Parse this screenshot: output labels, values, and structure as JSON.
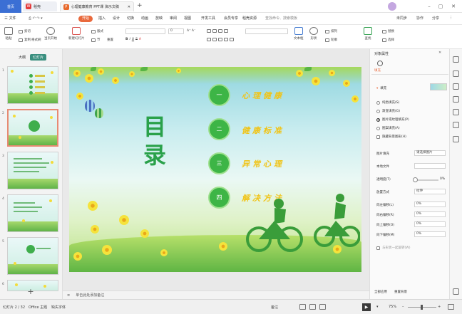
{
  "titlebar": {
    "home_tab": "首页",
    "wps_tab": "稻壳",
    "doc_tab": "心理健康教育 PPT课 演示文稿",
    "add_tab": "+",
    "minimize": "–",
    "restore": "▢",
    "close": "✕"
  },
  "menubar": {
    "file": "三 文件",
    "items": [
      "开始",
      "插入",
      "设计",
      "切换",
      "动画",
      "放映",
      "审阅",
      "视图",
      "开发工具",
      "会员专享",
      "稻壳资源"
    ],
    "search": "查找命令、搜索模板",
    "unsaved": "未同步",
    "collab": "协作",
    "share": "分享"
  },
  "ribbon": {
    "paste": "粘贴",
    "cut": "剪切",
    "copy": "复制",
    "format_painter": "格式刷",
    "play_from_current": "当页开始",
    "new_slide": "新建幻灯片",
    "layout": "版式",
    "section": "节",
    "reset": "重置",
    "font_size": "0",
    "text_box": "文本框",
    "shapes": "形状",
    "arrange": "排列",
    "outline": "轮廓",
    "find": "查找",
    "replace": "替换",
    "select": "选择"
  },
  "leftpanel": {
    "tab_outline": "大纲",
    "tab_slides": "幻灯片",
    "slide_numbers": [
      "1",
      "2",
      "3",
      "4",
      "5",
      "6"
    ],
    "add": "+"
  },
  "slide": {
    "title": "目录",
    "items": [
      {
        "num": "一",
        "text": "心理健康"
      },
      {
        "num": "二",
        "text": "健康标准"
      },
      {
        "num": "三",
        "text": "异常心理"
      },
      {
        "num": "四",
        "text": "解决方法"
      }
    ]
  },
  "notes": "单击此处添加备注",
  "rightpanel": {
    "header": "对象属性",
    "fill_label": "填充",
    "fill_options": [
      "纯色填充(S)",
      "渐变填充(G)",
      "图片或纹理填充(P)",
      "图案填充(A)",
      "隐藏背景图形(H)"
    ],
    "selected_option": 2,
    "image_fill": "图片填充",
    "image_fill_value": "请选择图片",
    "source": "本地文件",
    "transparency": "透明度(T)",
    "transparency_value": "0%",
    "offset_mode": "放置方式",
    "offset_value": "拉伸",
    "offsets": [
      {
        "label": "向左偏移(L)",
        "value": "0%"
      },
      {
        "label": "向右偏移(R)",
        "value": "0%"
      },
      {
        "label": "向上偏移(O)",
        "value": "0%"
      },
      {
        "label": "向下偏移(M)",
        "value": "0%"
      }
    ],
    "rotate_with_shape": "与形状一起旋转(W)",
    "apply_all": "全部应用",
    "reset_bg": "重置背景"
  },
  "statusbar": {
    "slide_info": "幻灯片 2 / 32",
    "theme": "Office 主题",
    "missing_font": "缺失字体",
    "notes": "备注",
    "zoom": "75%"
  },
  "colors": {
    "accent": "#e9693c",
    "slide_green": "#3db546",
    "slide_yellow": "#f0c418",
    "selected_thumb": "#e88a73"
  }
}
